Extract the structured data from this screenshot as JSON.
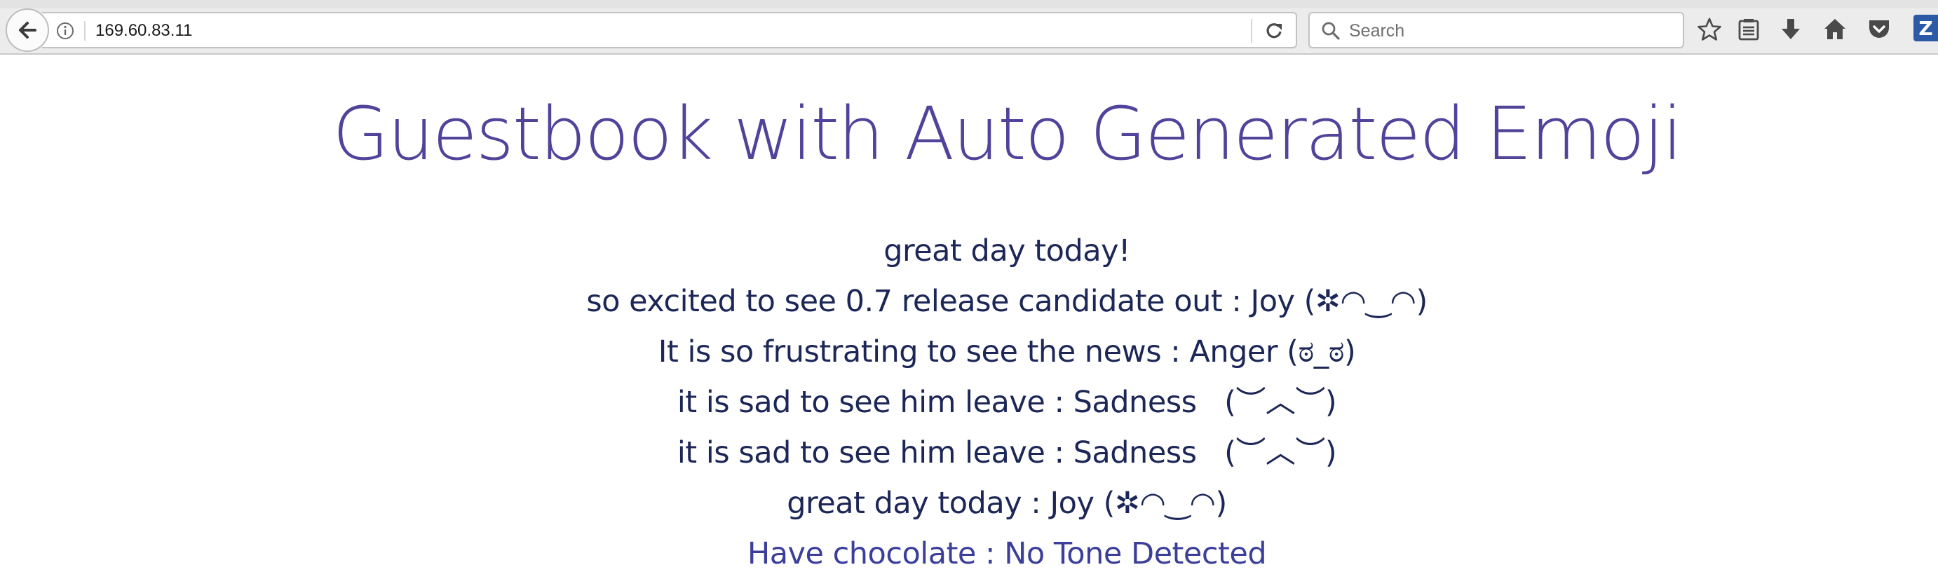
{
  "browser": {
    "url": "169.60.83.11",
    "search_placeholder": "Search",
    "zotero_label": "Z"
  },
  "page": {
    "title": "Guestbook with Auto Generated Emoji",
    "entries": [
      "great day today!",
      "so excited to see 0.7 release candidate out : Joy (✲◠‿◠)",
      "It is so frustrating to see the news : Anger (ಠ_ಠ)",
      "it is sad to see him leave : Sadness   (︶︿︶)",
      "it is sad to see him leave : Sadness   (︶︿︶)",
      "great day today : Joy (✲◠‿◠)",
      "Have chocolate : No Tone Detected"
    ]
  },
  "colors": {
    "title": "#50439a",
    "entry_text": "#1c2757",
    "zotero": "#2d5aa7"
  },
  "icons": [
    "back-arrow-icon",
    "info-icon",
    "reload-icon",
    "search-icon",
    "star-bookmark-icon",
    "reader-list-icon",
    "download-arrow-icon",
    "home-icon",
    "pocket-icon",
    "zotero-icon"
  ]
}
